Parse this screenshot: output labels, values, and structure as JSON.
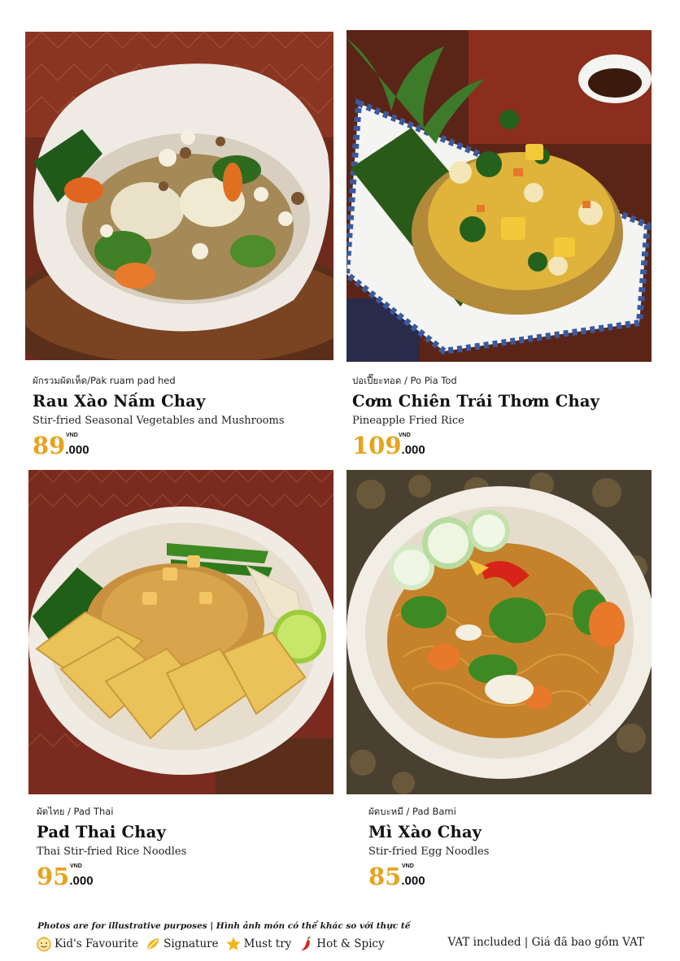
{
  "items": [
    {
      "thai": "ผักรวมผัดเห็ด/Pak ruam pad hed",
      "name": "Rau Xào Nấm Chay",
      "desc": "Stir-fried Seasonal Vegetables and Mushrooms",
      "price_main": "89",
      "price_thousands": ".000",
      "currency": "VND"
    },
    {
      "thai": "ปอเปี๊ยะทอด / Po Pia Tod",
      "name": "Cơm Chiên Trái Thơm Chay",
      "desc": "Pineapple Fried Rice",
      "price_main": "109",
      "price_thousands": ".000",
      "currency": "VND"
    },
    {
      "thai": "ผัดไทย / Pad Thai",
      "name": "Pad Thai Chay",
      "desc": "Thai Stir-fried Rice Noodles",
      "price_main": "95",
      "price_thousands": ".000",
      "currency": "VND"
    },
    {
      "thai": "ผัดบะหมี / Pad Bami",
      "name": "Mì Xào Chay",
      "desc": "Stir-fried Egg Noodles",
      "price_main": "85",
      "price_thousands": ".000",
      "currency": "VND"
    }
  ],
  "footer": {
    "note": "Photos are for illustrative purposes | Hình ảnh món có thể khác so với thực tế",
    "legend": [
      {
        "label": "Kid's Favourite",
        "icon": "kids-favourite-icon"
      },
      {
        "label": "Signature",
        "icon": "signature-leaf-icon"
      },
      {
        "label": "Must try",
        "icon": "star-icon"
      },
      {
        "label": "Hot & Spicy",
        "icon": "chili-icon"
      }
    ],
    "vat": "VAT included | Giá đã bao gồm VAT"
  },
  "colors": {
    "price_accent": "#e8a21c",
    "icon_yellow": "#f2b61c",
    "chili_red": "#d4281c"
  }
}
